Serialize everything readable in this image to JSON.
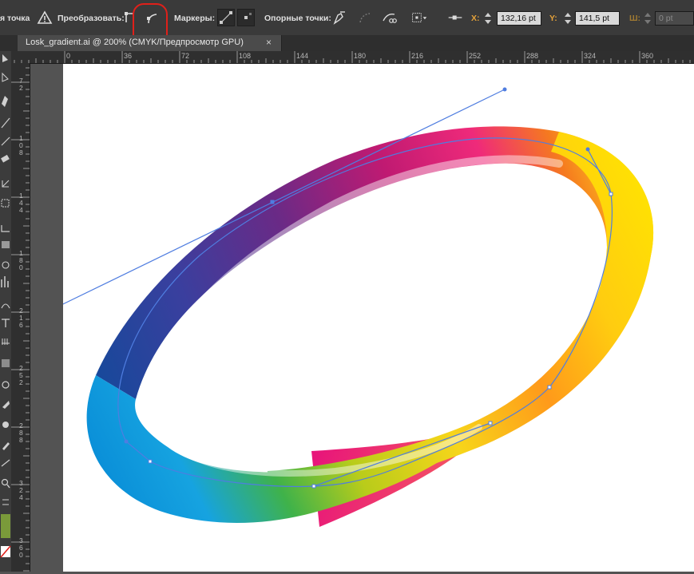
{
  "control_bar": {
    "anchor_point_label": "я точка",
    "convert_label": "Преобразовать:",
    "handles_label": "Маркеры:",
    "anchors_label": "Опорные точки:",
    "x_label": "X:",
    "x_value": "132,16 pt",
    "y_label": "Y:",
    "y_value": "141,5 pt",
    "w_label": "Ш:",
    "w_value": "0 pt"
  },
  "tab": {
    "title": "Losk_gradient.ai @ 200% (CMYK/Предпросмотр GPU)",
    "close": "×"
  },
  "ruler_h": [
    "0",
    "36",
    "72",
    "108",
    "144",
    "180",
    "216",
    "252",
    "288",
    "324",
    "360"
  ],
  "ruler_v": [
    {
      "digits": [
        "7",
        "2"
      ]
    },
    {
      "digits": [
        "1",
        "0",
        "8"
      ]
    },
    {
      "digits": [
        "1",
        "4",
        "4"
      ]
    },
    {
      "digits": [
        "1",
        "8",
        "0"
      ]
    },
    {
      "digits": [
        "2",
        "1",
        "6"
      ]
    },
    {
      "digits": [
        "2",
        "5",
        "2"
      ]
    },
    {
      "digits": [
        "2",
        "8",
        "8"
      ]
    },
    {
      "digits": [
        "3",
        "2",
        "4"
      ]
    },
    {
      "digits": [
        "3",
        "6",
        "0"
      ]
    }
  ],
  "colors": {
    "highlight": "#e0201a",
    "path": "#4f7de0",
    "xy_label": "#e5a23a"
  }
}
